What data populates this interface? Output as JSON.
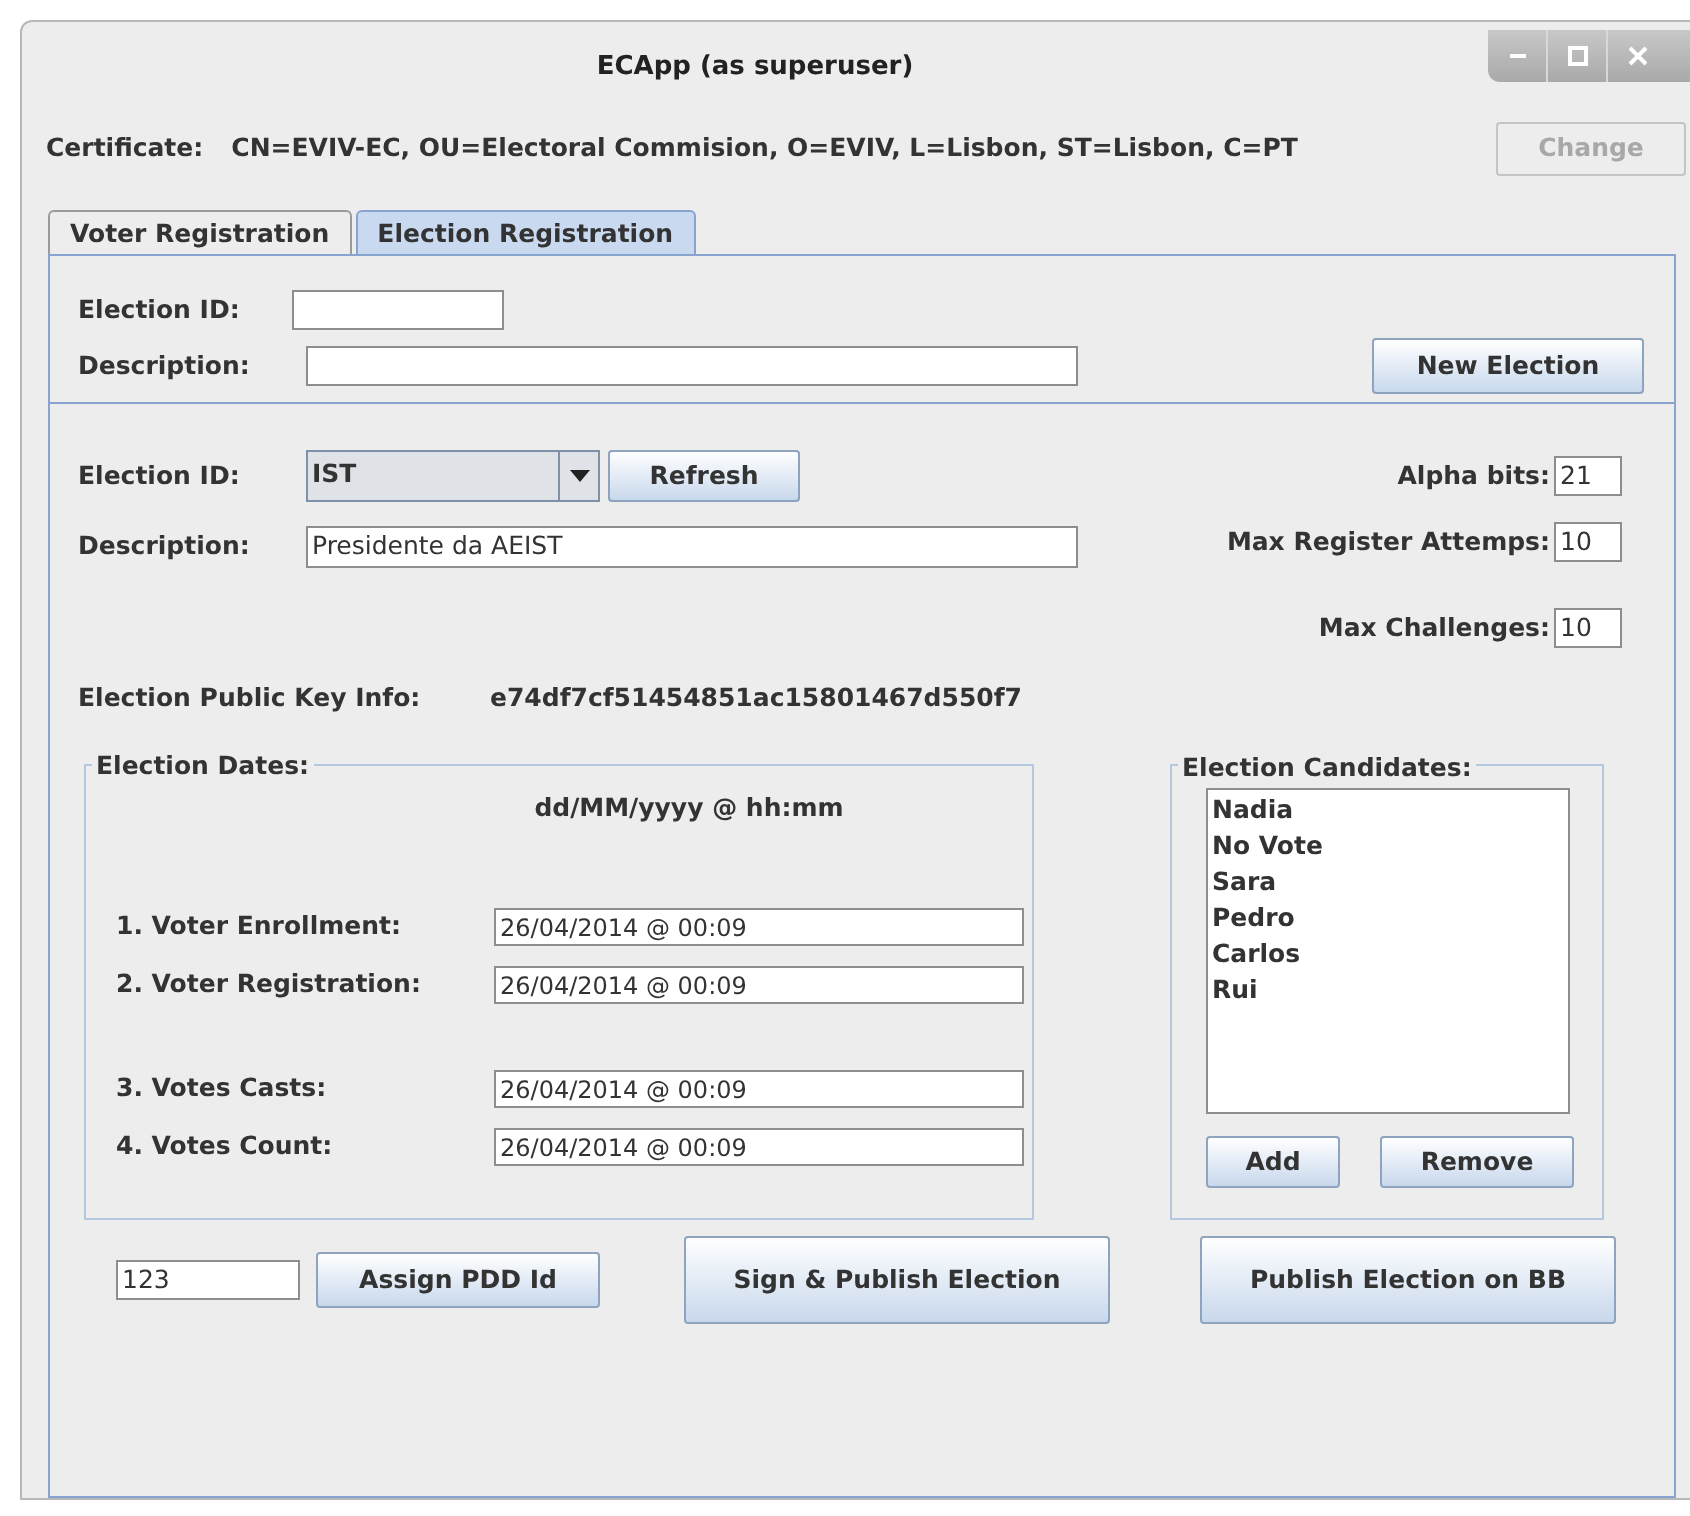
{
  "window": {
    "title": "ECApp (as superuser)"
  },
  "certificate": {
    "label": "Certificate:",
    "value": "CN=EVIV-EC, OU=Electoral Commision, O=EVIV, L=Lisbon, ST=Lisbon, C=PT",
    "change_button": {
      "label": "Change",
      "disabled": true
    }
  },
  "tabs": [
    {
      "label": "Voter Registration",
      "selected": false
    },
    {
      "label": "Election Registration",
      "selected": true
    }
  ],
  "new_election": {
    "id_label": "Election ID:",
    "description_label": "Description:",
    "button": "New Election"
  },
  "election": {
    "id_label": "Election ID:",
    "id_value": "IST",
    "refresh_button": "Refresh",
    "description_label": "Description:",
    "description_value": "Presidente da AEIST",
    "public_key_label": "Election Public Key Info:",
    "public_key_value": "e74df7cf51454851ac15801467d550f7",
    "settings": [
      {
        "label": "Alpha bits:",
        "value": "21"
      },
      {
        "label": "Max Register Attemps:",
        "value": "10"
      },
      {
        "label": "Max Challenges:",
        "value": "10"
      }
    ]
  },
  "dates": {
    "title": "Election Dates:",
    "format_hint": "dd/MM/yyyy @ hh:mm",
    "rows": [
      {
        "label": "1. Voter Enrollment:",
        "value": "26/04/2014 @ 00:09"
      },
      {
        "label": "2. Voter Registration:",
        "value": "26/04/2014 @ 00:09"
      },
      {
        "label": "3. Votes Casts:",
        "value": "26/04/2014 @ 00:09"
      },
      {
        "label": "4. Votes Count:",
        "value": "26/04/2014 @ 00:09"
      }
    ]
  },
  "candidates": {
    "title": "Election Candidates:",
    "items": [
      {
        "name": "Nadia",
        "selected": false
      },
      {
        "name": "No Vote",
        "selected": false
      },
      {
        "name": "Sara",
        "selected": false
      },
      {
        "name": "Pedro",
        "selected": false
      },
      {
        "name": "Carlos",
        "selected": false
      },
      {
        "name": "Rui",
        "selected": false
      }
    ],
    "add_button": "Add",
    "remove_button": "Remove"
  },
  "footer": {
    "pdd_id_value": "123",
    "assign_button": "Assign PDD Id",
    "sign_button": "Sign & Publish Election",
    "publish_button": "Publish Election on BB"
  }
}
